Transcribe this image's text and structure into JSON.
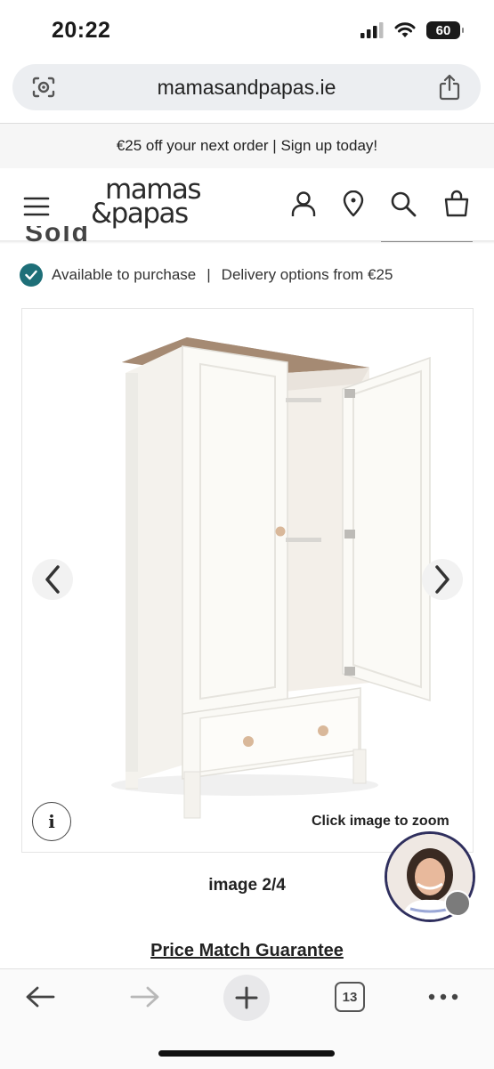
{
  "status_bar": {
    "time": "20:22",
    "battery": "60"
  },
  "browser": {
    "url": "mamasandpapas.ie",
    "tab_count": "13"
  },
  "promo": {
    "text": "€25 off your next order | Sign up today!"
  },
  "header": {
    "logo_line1": "mamas",
    "logo_line2": "&papas"
  },
  "product": {
    "clipped_heading": "Sold",
    "availability": "Available to purchase",
    "separator": "|",
    "delivery": "Delivery options from €25",
    "zoom_hint": "Click image to zoom",
    "image_counter": "image 2/4",
    "info_label": "i",
    "price_match": "Price Match Guarantee"
  },
  "colors": {
    "accent_teal": "#1e6f78",
    "avatar_ring": "#2f2f5e"
  },
  "icons": [
    "lens-icon",
    "share-icon",
    "menu-icon",
    "account-icon",
    "location-icon",
    "search-icon",
    "basket-icon",
    "check-icon",
    "chevron-left-icon",
    "chevron-right-icon",
    "back-arrow-icon",
    "forward-arrow-icon",
    "plus-icon",
    "tabs-icon",
    "more-icon"
  ]
}
